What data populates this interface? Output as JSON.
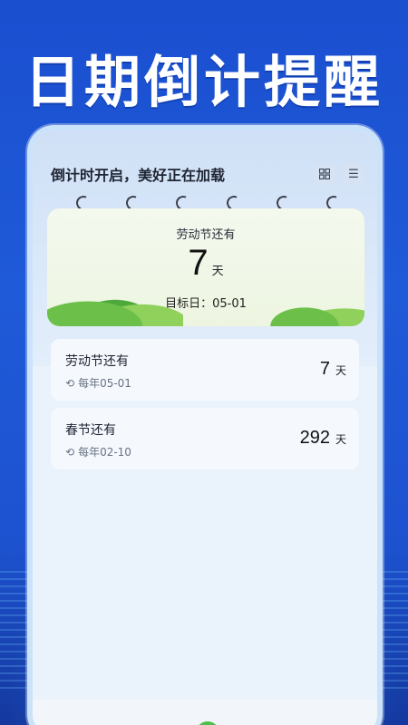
{
  "promo": {
    "title": "日期倒计提醒"
  },
  "header": {
    "title": "倒计时开启，美好正在加载",
    "grid_icon": "grid-icon",
    "menu_icon": "menu-icon"
  },
  "featured": {
    "title": "劳动节还有",
    "days": "7",
    "unit": "天",
    "target_date": "目标日：05-01"
  },
  "events": [
    {
      "name": "劳动节还有",
      "repeat": "每年05-01",
      "days": "7",
      "unit": "天"
    },
    {
      "name": "春节还有",
      "repeat": "每年02-10",
      "days": "292",
      "unit": "天"
    }
  ],
  "colors": {
    "brand_blue": "#1a4fd0",
    "accent_green": "#4cbf4a"
  }
}
